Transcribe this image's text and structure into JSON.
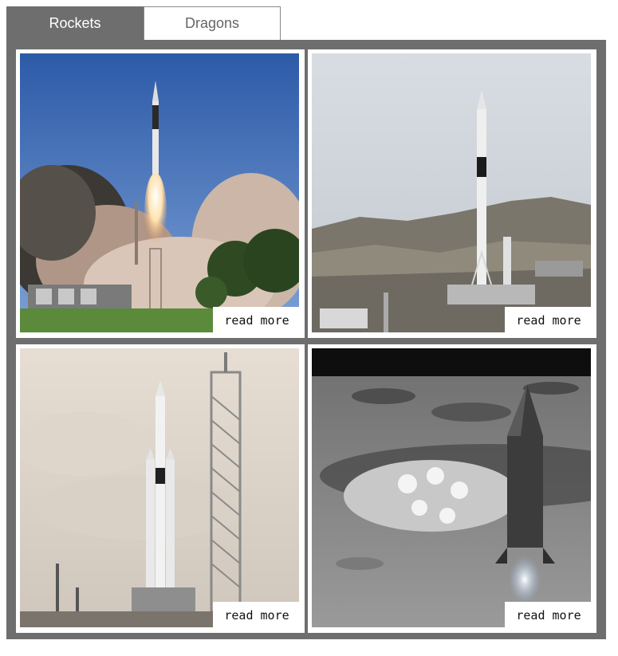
{
  "tabs": [
    {
      "label": "Rockets",
      "active": true
    },
    {
      "label": "Dragons",
      "active": false
    }
  ],
  "cards": [
    {
      "image": "falcon9-launch-image",
      "link_label": "read more"
    },
    {
      "image": "falcon9-on-pad-image",
      "link_label": "read more"
    },
    {
      "image": "falcon-heavy-image",
      "link_label": "read more"
    },
    {
      "image": "starship-moon-base-image",
      "link_label": "read more"
    }
  ],
  "colors": {
    "panel": "#6e6e6e",
    "active_tab": "#6e6e6e",
    "card_border": "#ffffff"
  }
}
